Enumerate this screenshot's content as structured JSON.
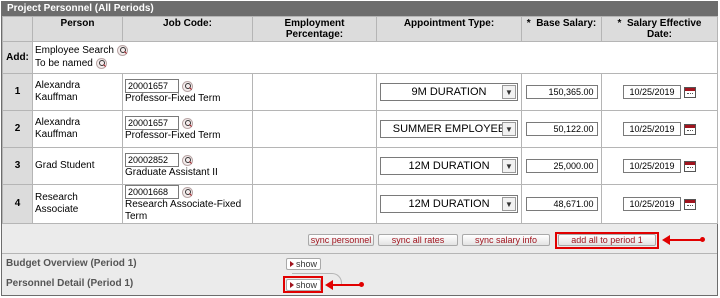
{
  "panel_title": "Project Personnel (All Periods)",
  "columns": {
    "person": "Person",
    "job_code": "Job Code:",
    "employment_pct": "Employment Percentage:",
    "appointment_type": "Appointment Type:",
    "base_salary": "Base Salary:",
    "salary_effective_date": "Salary Effective Date:",
    "required_marker": "*"
  },
  "add_row": {
    "label": "Add:",
    "employee_search": "Employee Search",
    "to_be_named": "To be named"
  },
  "rows": [
    {
      "num": "1",
      "person": "Alexandra Kauffman",
      "job_code": "20001657",
      "job_title": "Professor-Fixed Term",
      "appointment": "9M DURATION",
      "salary": "150,365.00",
      "date": "10/25/2019"
    },
    {
      "num": "2",
      "person": "Alexandra Kauffman",
      "job_code": "20001657",
      "job_title": "Professor-Fixed Term",
      "appointment": "SUMMER EMPLOYEE",
      "salary": "50,122.00",
      "date": "10/25/2019"
    },
    {
      "num": "3",
      "person": "Grad Student",
      "job_code": "20002852",
      "job_title": "Graduate Assistant II",
      "appointment": "12M DURATION",
      "salary": "25,000.00",
      "date": "10/25/2019"
    },
    {
      "num": "4",
      "person": "Research Associate",
      "job_code": "20001668",
      "job_title": "Research Associate-Fixed Term",
      "appointment": "12M DURATION",
      "salary": "48,671.00",
      "date": "10/25/2019"
    }
  ],
  "buttons": {
    "sync_personnel": "sync personnel",
    "sync_all_rates": "sync all rates",
    "sync_salary_info": "sync salary info",
    "add_all_to_period": "add all to period 1"
  },
  "sections": {
    "budget_overview": "Budget Overview (Period 1)",
    "personnel_detail": "Personnel Detail (Period 1)",
    "show_label": "show"
  },
  "icons": {
    "lookup": "magnifier-icon",
    "calendar": "calendar-icon",
    "dropdown": "chevron-down-icon",
    "show": "triangle-right-icon"
  },
  "colors": {
    "title_bar": "#6d6d6d",
    "header_bg": "#dcdcdc",
    "annotation": "#e10000",
    "link_red": "#a0141e"
  }
}
